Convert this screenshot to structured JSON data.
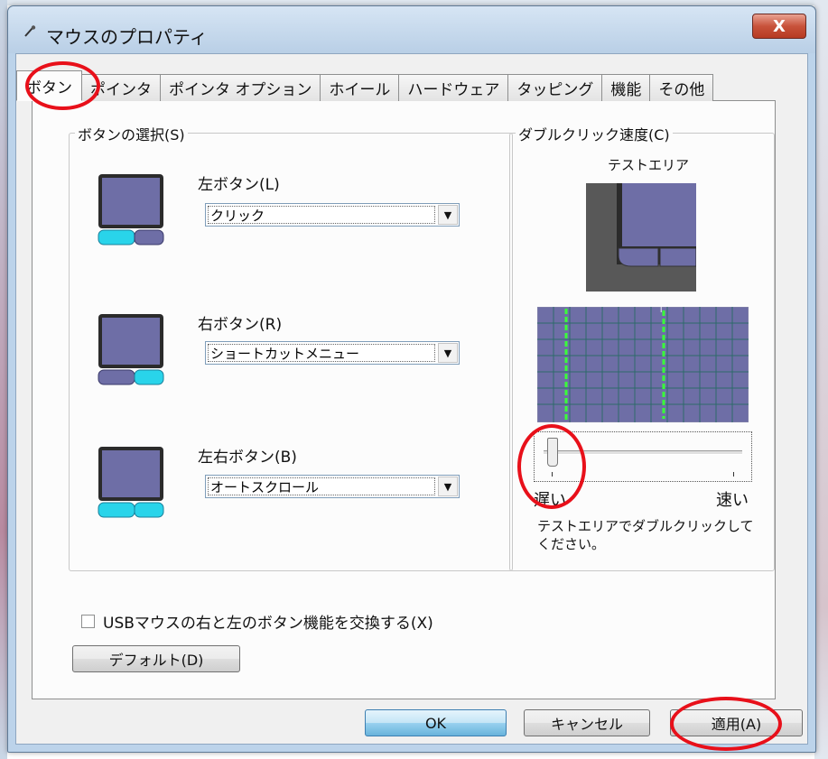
{
  "window": {
    "title": "マウスのプロパティ",
    "close_label": "X"
  },
  "tabs": [
    {
      "label": "ボタン",
      "active": true
    },
    {
      "label": "ポインタ"
    },
    {
      "label": "ポインタ オプション"
    },
    {
      "label": "ホイール"
    },
    {
      "label": "ハードウェア"
    },
    {
      "label": "タッピング"
    },
    {
      "label": "機能"
    },
    {
      "label": "その他"
    }
  ],
  "button_select": {
    "group_label": "ボタンの選択(S)",
    "left": {
      "label": "左ボタン(L)",
      "value": "クリック"
    },
    "right": {
      "label": "右ボタン(R)",
      "value": "ショートカットメニュー"
    },
    "both": {
      "label": "左右ボタン(B)",
      "value": "オートスクロール"
    }
  },
  "double_click": {
    "group_label": "ダブルクリック速度(C)",
    "test_area_label": "テストエリア",
    "slow_label": "遅い",
    "fast_label": "速い",
    "speed_level": 0.08,
    "instruction_line1": "テストエリアでダブルクリックして",
    "instruction_line2": "ください。"
  },
  "swap": {
    "label": "USBマウスの右と左のボタン機能を交換する(X)",
    "checked": false
  },
  "default_button": "デフォルト(D)",
  "dialog_buttons": {
    "ok": "OK",
    "cancel": "キャンセル",
    "apply": "適用(A)"
  }
}
